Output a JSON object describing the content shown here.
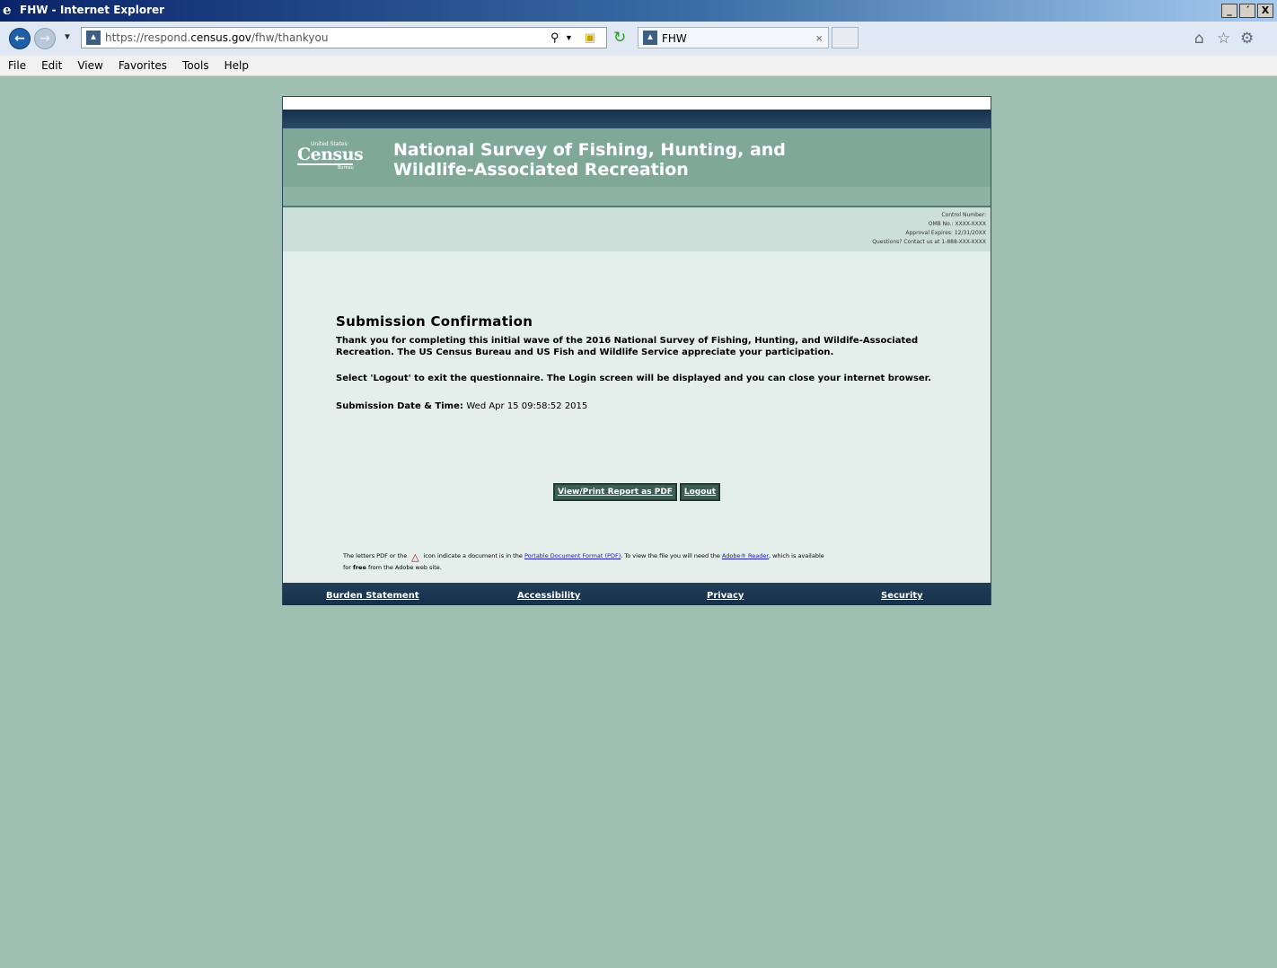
{
  "window": {
    "title": "FHW - Internet Explorer",
    "buttons": [
      "_",
      "´",
      "X"
    ]
  },
  "browser": {
    "url_prefix": "https://respond.",
    "url_domain": "census.gov",
    "url_path": "/fhw/thankyou",
    "tab_title": "FHW"
  },
  "menu": [
    "File",
    "Edit",
    "View",
    "Favorites",
    "Tools",
    "Help"
  ],
  "header": {
    "logo_small": "United States·",
    "logo_big": "Census",
    "logo_bureau": "Bureau",
    "title_line1": "National Survey of Fishing, Hunting, and",
    "title_line2": "Wildlife-Associated Recreation"
  },
  "info": {
    "control": "Control Number:",
    "omb": "OMB No.: XXXX-XXXX",
    "approval": "Approval Expires: 12/31/20XX",
    "questions": "Questions? Contact us at 1-888-XXX-XXXX"
  },
  "confirmation": {
    "heading": "Submission Confirmation",
    "message1": "Thank you for completing this initial wave of the 2016 National Survey of Fishing, Hunting, and Wildife-Associated Recreation. The US Census Bureau and US Fish and Wildlife Service appreciate your participation.",
    "message2": "Select 'Logout' to exit the questionnaire. The Login screen will be displayed and you can close your internet browser.",
    "date_label": "Submission Date & Time:",
    "date_value": "Wed Apr 15 09:58:52 2015"
  },
  "buttons": {
    "pdf": "View/Print Report as PDF",
    "logout": "Logout"
  },
  "pdf_note": {
    "part1": "The letters PDF or the",
    "part2": "icon indicate a document is in the",
    "link1": "Portable Document Format (PDF)",
    "part3": ". To view the file you will need the",
    "link2": "Adobe® Reader",
    "part4": ", which is available",
    "part5": "for",
    "free": "free",
    "part6": "from the Adobe web site."
  },
  "footer": {
    "burden": "Burden Statement",
    "accessibility": "Accessibility",
    "privacy": "Privacy",
    "security": "Security"
  }
}
